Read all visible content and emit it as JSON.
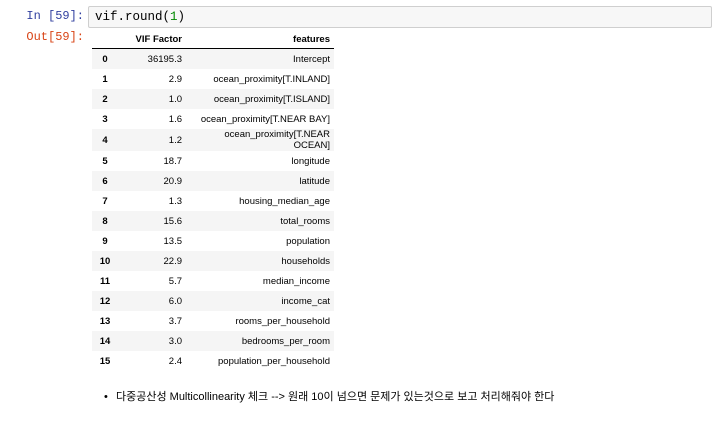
{
  "input_cell": {
    "prompt": "In [59]:",
    "code_prefix": "vif.round(",
    "code_arg": "1",
    "code_suffix": ")"
  },
  "output_cell": {
    "prompt": "Out[59]:"
  },
  "table": {
    "columns": [
      "",
      "VIF Factor",
      "features"
    ],
    "rows": [
      {
        "idx": "0",
        "vif": "36195.3",
        "feature": "Intercept"
      },
      {
        "idx": "1",
        "vif": "2.9",
        "feature": "ocean_proximity[T.INLAND]"
      },
      {
        "idx": "2",
        "vif": "1.0",
        "feature": "ocean_proximity[T.ISLAND]"
      },
      {
        "idx": "3",
        "vif": "1.6",
        "feature": "ocean_proximity[T.NEAR BAY]"
      },
      {
        "idx": "4",
        "vif": "1.2",
        "feature": "ocean_proximity[T.NEAR OCEAN]"
      },
      {
        "idx": "5",
        "vif": "18.7",
        "feature": "longitude"
      },
      {
        "idx": "6",
        "vif": "20.9",
        "feature": "latitude"
      },
      {
        "idx": "7",
        "vif": "1.3",
        "feature": "housing_median_age"
      },
      {
        "idx": "8",
        "vif": "15.6",
        "feature": "total_rooms"
      },
      {
        "idx": "9",
        "vif": "13.5",
        "feature": "population"
      },
      {
        "idx": "10",
        "vif": "22.9",
        "feature": "households"
      },
      {
        "idx": "11",
        "vif": "5.7",
        "feature": "median_income"
      },
      {
        "idx": "12",
        "vif": "6.0",
        "feature": "income_cat"
      },
      {
        "idx": "13",
        "vif": "3.7",
        "feature": "rooms_per_household"
      },
      {
        "idx": "14",
        "vif": "3.0",
        "feature": "bedrooms_per_room"
      },
      {
        "idx": "15",
        "vif": "2.4",
        "feature": "population_per_household"
      }
    ]
  },
  "note": {
    "bullet": "•",
    "text": "다중공산성 Multicollinearity 체크 --> 원래 10이 넘으면 문제가 있는것으로 보고 처리해줘야 한다"
  }
}
